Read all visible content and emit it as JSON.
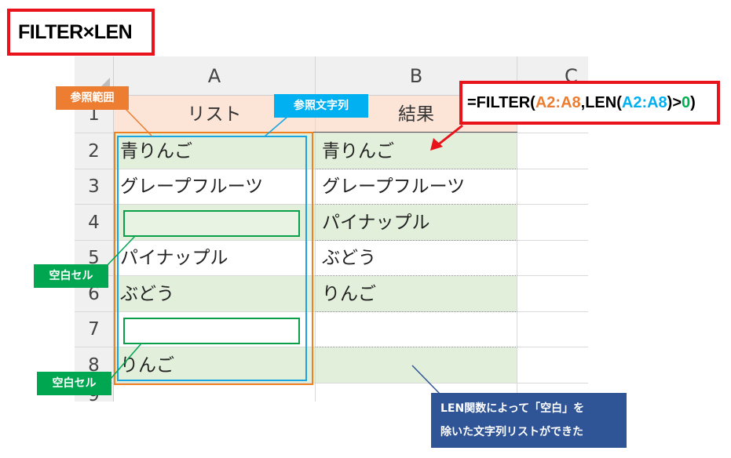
{
  "title": "FILTER×LEN",
  "columns": [
    "A",
    "B",
    "C"
  ],
  "rows": [
    "1",
    "2",
    "3",
    "4",
    "5",
    "6",
    "7",
    "8",
    "9"
  ],
  "headers": {
    "a1": "リスト",
    "b1": "結果"
  },
  "column_a": [
    "青りんご",
    "グレープフルーツ",
    "",
    "パイナップル",
    "ぶどう",
    "",
    "りんご"
  ],
  "column_b": [
    "青りんご",
    "グレープフルーツ",
    "パイナップル",
    "ぶどう",
    "りんご",
    "",
    ""
  ],
  "callouts": {
    "reference_range": "参照範囲",
    "reference_string": "参照文字列",
    "blank_cell_1": "空白セル",
    "blank_cell_2": "空白セル",
    "note_line1": "LEN関数によって「空白」を",
    "note_line2": "除いた文字列リストができた"
  },
  "formula": {
    "p1": "=FILTER(",
    "p2": "A2:A8",
    "p3": ",LEN(",
    "p4": "A2:A8",
    "p5": ")>",
    "p6": "0",
    "p7": ")"
  },
  "colors": {
    "red": "#e8131b",
    "orange": "#ed7d31",
    "blue": "#00b0f0",
    "green": "#00a650",
    "navy": "#2f5597",
    "header_fill": "#fce4d6",
    "row_fill": "#e2efda"
  }
}
